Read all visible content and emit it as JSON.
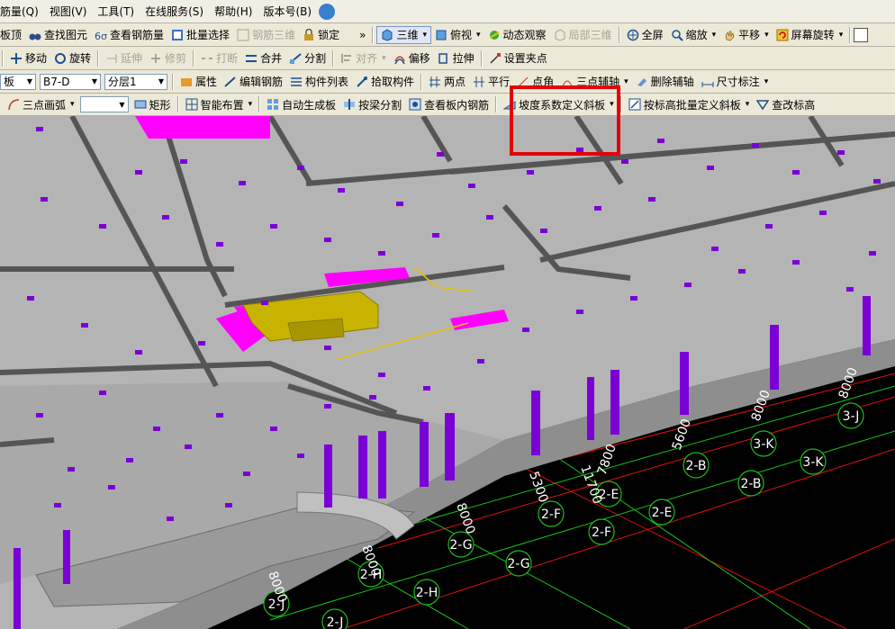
{
  "menu": [
    "筋量(Q)",
    "视图(V)",
    "工具(T)",
    "在线服务(S)",
    "帮助(H)",
    "版本号(B)"
  ],
  "toolbar1": {
    "left": [
      "板顶",
      "查找图元",
      "查看钢筋量",
      "批量选择",
      "钢筋三维",
      "锁定"
    ],
    "overflow": "»",
    "right": [
      "三维",
      "俯视",
      "动态观察",
      "局部三维",
      "全屏",
      "缩放",
      "平移",
      "屏幕旋转"
    ]
  },
  "toolbar2": [
    "移动",
    "旋转",
    "延伸",
    "修剪",
    "打断",
    "合并",
    "分割",
    "对齐",
    "偏移",
    "拉伸",
    "设置夹点"
  ],
  "toolbar3": {
    "combo1": "板",
    "combo2": "B7-D",
    "combo3": "分层1",
    "buttons": [
      "属性",
      "编辑钢筋",
      "构件列表",
      "拾取构件",
      "两点",
      "平行",
      "点角",
      "三点辅轴",
      "删除辅轴",
      "尺寸标注"
    ]
  },
  "toolbar4": {
    "arc": "三点画弧",
    "combo": "",
    "buttons": [
      "矩形",
      "智能布置",
      "自动生成板",
      "按梁分割",
      "查看板内钢筋",
      "坡度系数定义斜板",
      "按标高批量定义斜板",
      "查改标高"
    ]
  },
  "viewport": {
    "axis_labels": [
      "3-J",
      "3-K",
      "3-K",
      "2-B",
      "2-B",
      "2-E",
      "2-E",
      "2-F",
      "2-F",
      "2-G",
      "2-G",
      "2-H",
      "2-H",
      "2-J",
      "2-J"
    ],
    "dimensions": [
      "8000",
      "8000",
      "5600",
      "7800",
      "11700",
      "5300",
      "8000",
      "8000",
      "8000"
    ]
  },
  "colors": {
    "toolbar_bg": "#ece9d8",
    "highlight": "#e3000b",
    "slab": "#b4b4b4",
    "column": "#7a00d6",
    "beam_pink": "#ff00ff",
    "beam_yellow": "#c8b400"
  }
}
